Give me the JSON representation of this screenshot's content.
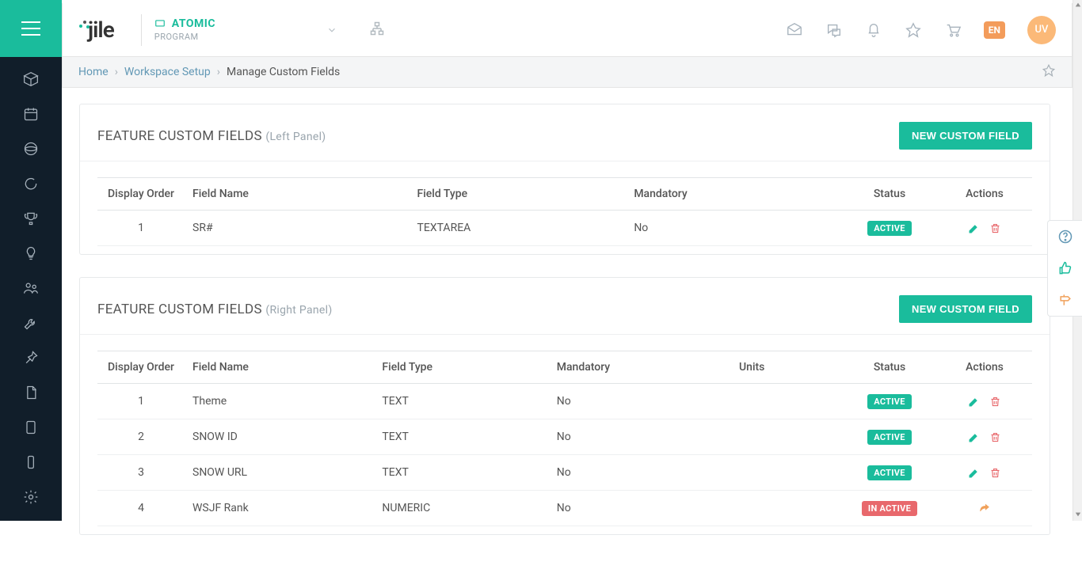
{
  "header": {
    "logo_text": "jile",
    "project_name": "ATOMIC",
    "project_type": "PROGRAM",
    "lang": "EN",
    "avatar": "UV"
  },
  "breadcrumb": {
    "home": "Home",
    "workspace": "Workspace Setup",
    "current": "Manage Custom Fields"
  },
  "buttons": {
    "new_custom_field": "NEW CUSTOM FIELD"
  },
  "columns": {
    "display_order": "Display Order",
    "field_name": "Field Name",
    "field_type": "Field Type",
    "mandatory": "Mandatory",
    "units": "Units",
    "status": "Status",
    "actions": "Actions"
  },
  "status_labels": {
    "active": "ACTIVE",
    "inactive": "IN ACTIVE"
  },
  "panel_left": {
    "title": "FEATURE CUSTOM FIELDS",
    "sub": "(Left Panel)",
    "rows": [
      {
        "order": "1",
        "name": "SR#",
        "type": "TEXTAREA",
        "mandatory": "No",
        "status": "active"
      }
    ]
  },
  "panel_right": {
    "title": "FEATURE CUSTOM FIELDS",
    "sub": "(Right Panel)",
    "rows": [
      {
        "order": "1",
        "name": "Theme",
        "type": "TEXT",
        "mandatory": "No",
        "units": "",
        "status": "active"
      },
      {
        "order": "2",
        "name": "SNOW ID",
        "type": "TEXT",
        "mandatory": "No",
        "units": "",
        "status": "active"
      },
      {
        "order": "3",
        "name": "SNOW URL",
        "type": "TEXT",
        "mandatory": "No",
        "units": "",
        "status": "active"
      },
      {
        "order": "4",
        "name": "WSJF Rank",
        "type": "NUMERIC",
        "mandatory": "No",
        "units": "",
        "status": "inactive"
      }
    ]
  }
}
